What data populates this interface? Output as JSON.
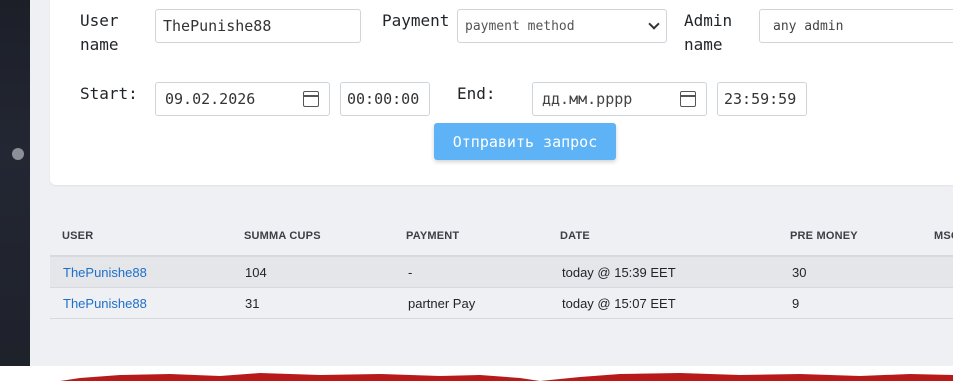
{
  "filters": {
    "user_label": "User name",
    "user_value": "ThePunishe88",
    "payment_label": "Payment",
    "payment_selected": "payment method",
    "admin_label": "Admin name",
    "admin_placeholder": "any admin",
    "start_label": "Start:",
    "start_date": "09.02.2026",
    "start_time": "00:00:00",
    "end_label": "End:",
    "end_date_placeholder": "дд.мм.рррр",
    "end_time": "23:59:59",
    "submit_label": "Отправить запрос"
  },
  "table": {
    "headers": [
      "USER",
      "SUMMA CUPS",
      "PAYMENT",
      "DATE",
      "PRE MONEY",
      "MSC"
    ],
    "rows": [
      {
        "user": "ThePunishe88",
        "summa": "104",
        "payment": "-",
        "date": "today @ 15:39 EET",
        "pre_money": "30"
      },
      {
        "user": "ThePunishe88",
        "summa": "31",
        "payment": "partner Pay",
        "date": "today @ 15:07 EET",
        "pre_money": "9"
      }
    ]
  },
  "colors": {
    "accent": "#5eb3f7",
    "link": "#1e6fc9",
    "sidebar": "#1c1f28"
  }
}
